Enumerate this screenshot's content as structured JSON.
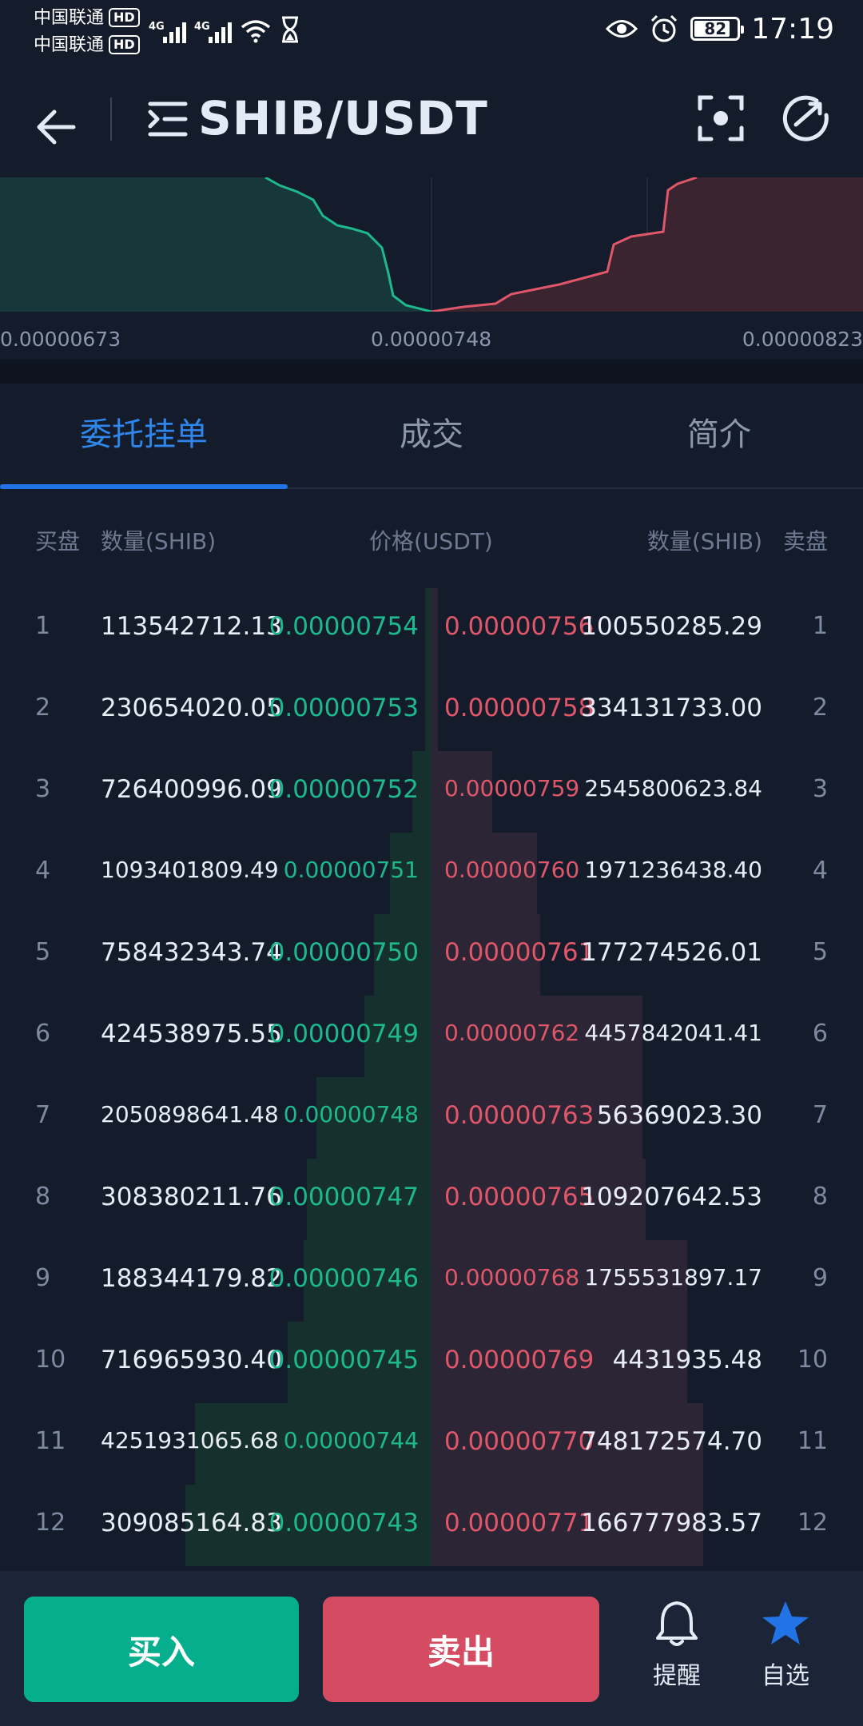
{
  "status_bar": {
    "carrier_1": "中国联通",
    "carrier_2": "中国联通",
    "hd_badge": "HD",
    "network_1": "4G",
    "network_2": "4G",
    "battery": "82",
    "time": "17:19"
  },
  "header": {
    "title": "SHIB/USDT"
  },
  "depth_chart": {
    "price_low": "0.00000673",
    "price_mid": "0.00000748",
    "price_high": "0.00000823",
    "colors": {
      "bid": "#1db98c",
      "ask": "#e05769"
    }
  },
  "tabs": [
    {
      "label": "委托挂单",
      "active": true
    },
    {
      "label": "成交",
      "active": false
    },
    {
      "label": "简介",
      "active": false
    }
  ],
  "order_book": {
    "header": {
      "bid_side": "买盘",
      "bid_qty": "数量(SHIB)",
      "price": "价格(USDT)",
      "ask_qty": "数量(SHIB)",
      "ask_side": "卖盘"
    },
    "rows": [
      {
        "index": "1",
        "bid_qty": "113542712.13",
        "bid_price": "0.00000754",
        "ask_price": "0.00000756",
        "ask_qty": "100550285.29",
        "bid_depth": 0.02,
        "ask_depth": 0.02
      },
      {
        "index": "2",
        "bid_qty": "230654020.05",
        "bid_price": "0.00000753",
        "ask_price": "0.00000758",
        "ask_qty": "334131733.00",
        "bid_depth": 0.02,
        "ask_depth": 0.02
      },
      {
        "index": "3",
        "bid_qty": "726400996.09",
        "bid_price": "0.00000752",
        "ask_price": "0.00000759",
        "ask_qty": "2545800623.84",
        "bid_depth": 0.06,
        "ask_depth": 0.19
      },
      {
        "index": "4",
        "bid_qty": "1093401809.49",
        "bid_price": "0.00000751",
        "ask_price": "0.00000760",
        "ask_qty": "1971236438.40",
        "bid_depth": 0.13,
        "ask_depth": 0.33
      },
      {
        "index": "5",
        "bid_qty": "758432343.74",
        "bid_price": "0.00000750",
        "ask_price": "0.00000761",
        "ask_qty": "177274526.01",
        "bid_depth": 0.18,
        "ask_depth": 0.34
      },
      {
        "index": "6",
        "bid_qty": "424538975.55",
        "bid_price": "0.00000749",
        "ask_price": "0.00000762",
        "ask_qty": "4457842041.41",
        "bid_depth": 0.21,
        "ask_depth": 0.66
      },
      {
        "index": "7",
        "bid_qty": "2050898641.48",
        "bid_price": "0.00000748",
        "ask_price": "0.00000763",
        "ask_qty": "56369023.30",
        "bid_depth": 0.36,
        "ask_depth": 0.66
      },
      {
        "index": "8",
        "bid_qty": "308380211.76",
        "bid_price": "0.00000747",
        "ask_price": "0.00000765",
        "ask_qty": "109207642.53",
        "bid_depth": 0.39,
        "ask_depth": 0.67
      },
      {
        "index": "9",
        "bid_qty": "188344179.82",
        "bid_price": "0.00000746",
        "ask_price": "0.00000768",
        "ask_qty": "1755531897.17",
        "bid_depth": 0.4,
        "ask_depth": 0.8
      },
      {
        "index": "10",
        "bid_qty": "716965930.40",
        "bid_price": "0.00000745",
        "ask_price": "0.00000769",
        "ask_qty": "4431935.48",
        "bid_depth": 0.45,
        "ask_depth": 0.8
      },
      {
        "index": "11",
        "bid_qty": "4251931065.68",
        "bid_price": "0.00000744",
        "ask_price": "0.00000770",
        "ask_qty": "748172574.70",
        "bid_depth": 0.74,
        "ask_depth": 0.85
      },
      {
        "index": "12",
        "bid_qty": "309085164.83",
        "bid_price": "0.00000743",
        "ask_price": "0.00000771",
        "ask_qty": "166777983.57",
        "bid_depth": 0.77,
        "ask_depth": 0.85
      }
    ]
  },
  "bottom_bar": {
    "buy_label": "买入",
    "sell_label": "卖出",
    "alert_label": "提醒",
    "favorite_label": "自选",
    "colors": {
      "buy": "#05ae8c",
      "sell": "#d44b62",
      "favorite": "#2173e6"
    }
  }
}
